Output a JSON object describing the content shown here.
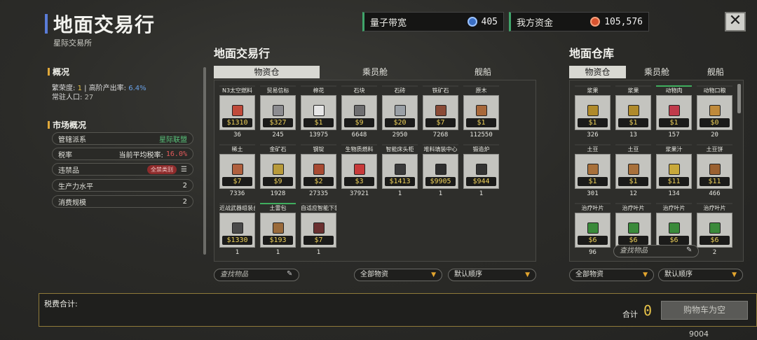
{
  "header": {
    "title": "地面交易行",
    "subtitle": "星际交易所",
    "bandwidth": {
      "label": "量子带宽",
      "value": "405",
      "icon": "bandwidth-icon"
    },
    "funds": {
      "label": "我方资金",
      "value": "105,576",
      "icon": "funds-icon"
    },
    "close": "✕"
  },
  "overview": {
    "title": "概况",
    "line1": {
      "prosperity_label": "繁荣度:",
      "prosperity": "1",
      "sep": "|",
      "high_output_label": "高阶产出率:",
      "high_output": "6.4%"
    },
    "line2": {
      "population_label": "常驻人口:",
      "population": "27"
    }
  },
  "market": {
    "title": "市场概况",
    "rows": [
      {
        "label": "管辖派系",
        "value": "星际联盟"
      },
      {
        "label": "税率",
        "mid": "当前平均税率:",
        "value": "16.0%"
      },
      {
        "label": "违禁品",
        "value": "全禁类别",
        "icon": "list-icon"
      },
      {
        "label": "生产力水平",
        "value": "2"
      },
      {
        "label": "消费规模",
        "value": "2"
      }
    ]
  },
  "left_panel": {
    "title": "地面交易行",
    "tabs": [
      "物资仓",
      "乘员舱",
      "舰船"
    ],
    "items": [
      {
        "name": "N3太空燃料",
        "price": "$1310",
        "qty": "36",
        "color": "#c04a3a"
      },
      {
        "name": "贸易信标",
        "price": "$327",
        "qty": "245",
        "color": "#8c8c90"
      },
      {
        "name": "棉花",
        "price": "$1",
        "qty": "13975",
        "color": "#e6e6e6"
      },
      {
        "name": "石块",
        "price": "$9",
        "qty": "6648",
        "color": "#6e6e70"
      },
      {
        "name": "石砖",
        "price": "$20",
        "qty": "2950",
        "color": "#9aa0a6"
      },
      {
        "name": "铁矿石",
        "price": "$7",
        "qty": "7268",
        "color": "#8a4a36"
      },
      {
        "name": "原木",
        "price": "$1",
        "qty": "112550",
        "color": "#a8683a"
      },
      {
        "name": "稀土",
        "price": "$7",
        "qty": "7336",
        "color": "#b0603e"
      },
      {
        "name": "金矿石",
        "price": "$9",
        "qty": "1928",
        "color": "#b89a3a"
      },
      {
        "name": "钢锭",
        "price": "$2",
        "qty": "27335",
        "color": "#a84a32"
      },
      {
        "name": "生物质燃料",
        "price": "$3",
        "qty": "37921",
        "color": "#c83a3a"
      },
      {
        "name": "智能床头柜",
        "price": "$1413",
        "qty": "1",
        "color": "#3a3a3a"
      },
      {
        "name": "堆料填装中心",
        "price": "$9905",
        "qty": "1",
        "color": "#2e2e2e"
      },
      {
        "name": "锻造炉",
        "price": "$944",
        "qty": "1",
        "color": "#333333"
      },
      {
        "name": "近战武器组装台",
        "price": "$1330",
        "qty": "1",
        "color": "#4a4a4a"
      },
      {
        "name": "土雷包",
        "price": "$193",
        "qty": "1",
        "color": "#9a6a3a"
      },
      {
        "name": "自适应智能下装",
        "price": "$7",
        "qty": "1",
        "color": "#6a3030"
      }
    ],
    "search_placeholder": "查找物品",
    "filter": "全部物资",
    "sort": "默认顺序"
  },
  "right_panel": {
    "title": "地面仓库",
    "tabs": [
      "物资仓",
      "乘员舱",
      "舰船"
    ],
    "items": [
      {
        "name": "浆果",
        "price": "$1",
        "qty": "326",
        "color": "#b08a2a"
      },
      {
        "name": "浆果",
        "price": "$1",
        "qty": "13",
        "color": "#b08a2a"
      },
      {
        "name": "动物肉",
        "price": "$1",
        "qty": "157",
        "color": "#c03a4a"
      },
      {
        "name": "动物口粮",
        "price": "$0",
        "qty": "20",
        "color": "#c08a3a"
      },
      {
        "name": "土豆",
        "price": "$1",
        "qty": "301",
        "color": "#a8703a"
      },
      {
        "name": "土豆",
        "price": "$1",
        "qty": "12",
        "color": "#a8703a"
      },
      {
        "name": "浆果汁",
        "price": "$11",
        "qty": "134",
        "color": "#c8a83a"
      },
      {
        "name": "土豆饼",
        "price": "$11",
        "qty": "466",
        "color": "#9a6030"
      },
      {
        "name": "治疗叶片",
        "price": "$6",
        "qty": "96",
        "color": "#3a8a3a"
      },
      {
        "name": "治疗叶片",
        "price": "$6",
        "qty": "",
        "color": "#3a8a3a"
      },
      {
        "name": "治疗叶片",
        "price": "$6",
        "qty": "",
        "color": "#3a8a3a"
      },
      {
        "name": "治疗叶片",
        "price": "$6",
        "qty": "2",
        "color": "#3a8a3a"
      }
    ],
    "search_placeholder": "查找物品",
    "filter": "全部物资",
    "sort": "默认顺序"
  },
  "bottom": {
    "tax_label": "税费合计:",
    "total_label": "合计",
    "total_value": "0",
    "cart_button": "购物车为空",
    "footer_number": "9004"
  }
}
